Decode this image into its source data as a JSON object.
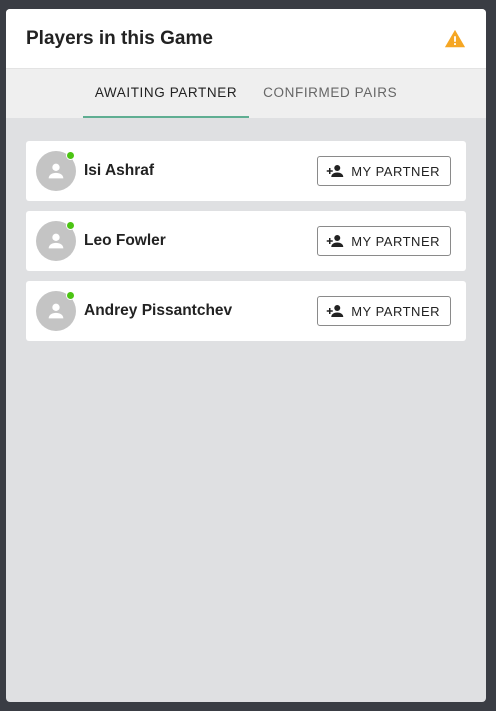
{
  "header": {
    "title": "Players in this Game",
    "warning_color": "#f5a623",
    "warning_icon": "warning-icon"
  },
  "tabs": [
    {
      "label": "AWAITING PARTNER",
      "active": true
    },
    {
      "label": "CONFIRMED PAIRS",
      "active": false
    }
  ],
  "accent_color": "#5fae92",
  "online_color": "#4cc413",
  "players": [
    {
      "name": "Isi Ashraf",
      "online": true,
      "button_label": "MY PARTNER"
    },
    {
      "name": "Leo Fowler",
      "online": true,
      "button_label": "MY PARTNER"
    },
    {
      "name": "Andrey Pissantchev",
      "online": true,
      "button_label": "MY PARTNER"
    }
  ]
}
